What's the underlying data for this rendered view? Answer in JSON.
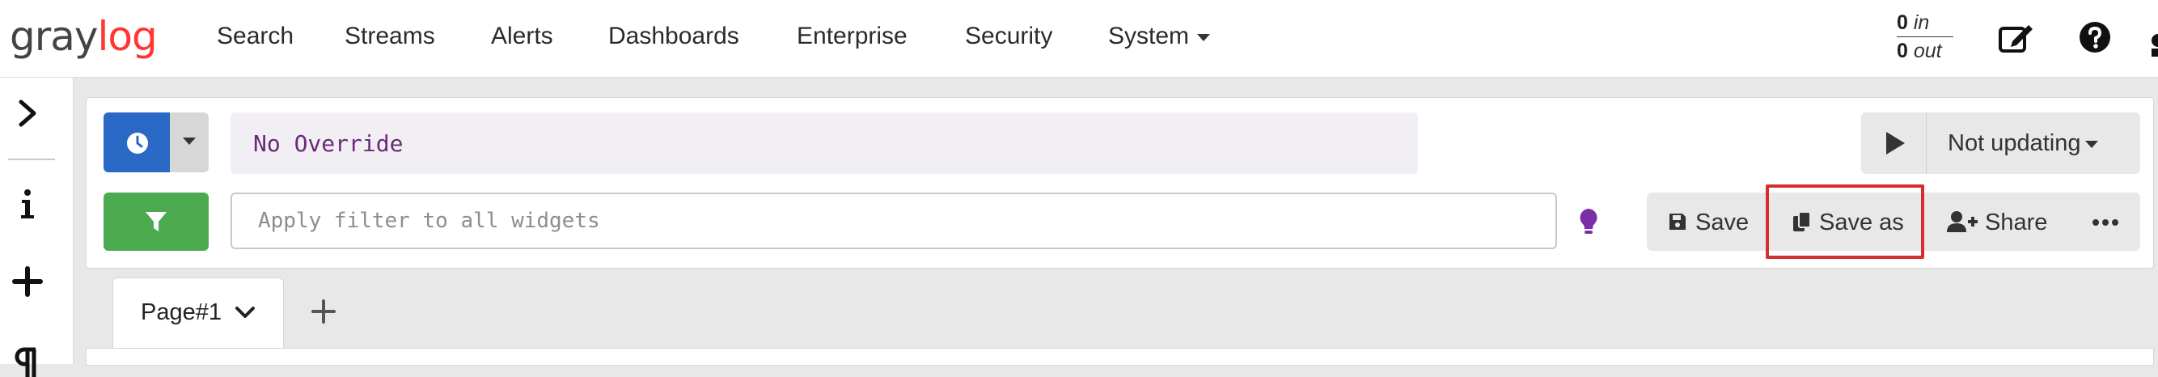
{
  "app": {
    "logo_text_gray": "gray",
    "logo_text_red": "log",
    "brand_color": "#ff3633"
  },
  "nav": {
    "items": [
      "Search",
      "Streams",
      "Alerts",
      "Dashboards",
      "Enterprise",
      "Security",
      "System"
    ],
    "system_has_dropdown": true
  },
  "throughput": {
    "in_value": "0",
    "in_label": "in",
    "out_value": "0",
    "out_label": "out"
  },
  "topbar_icons": [
    "edit-icon",
    "help-icon"
  ],
  "sidebar": {
    "icons": [
      "chevron-right-icon",
      "info-icon",
      "plus-icon",
      "paragraph-icon"
    ]
  },
  "search": {
    "time_range_text": "No Override",
    "refresh_label": "Not updating",
    "filter_placeholder": "Apply filter to all widgets",
    "colors": {
      "time_button": "#2a68c6",
      "filter_button": "#4cab4f",
      "highlight": "#d32f2f",
      "time_text": "#6a2a77"
    }
  },
  "actions": {
    "save_label": "Save",
    "save_as_label": "Save as",
    "share_label": "Share",
    "more_icon": "ellipsis-icon"
  },
  "tabs": {
    "items": [
      {
        "label": "Page#1"
      }
    ]
  }
}
